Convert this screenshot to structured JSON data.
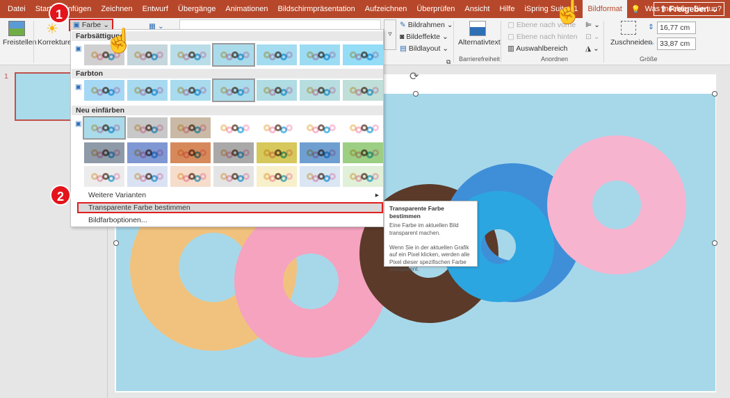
{
  "tabs": [
    "Datei",
    "Start",
    "Einfügen",
    "Zeichnen",
    "Entwurf",
    "Übergänge",
    "Animationen",
    "Bildschirmpräsentation",
    "Aufzeichnen",
    "Überprüfen",
    "Ansicht",
    "Hilfe",
    "iSpring Suite 11",
    "Bildformat"
  ],
  "active_tab": "Bildformat",
  "tell_me": "Was möchten Sie tun?",
  "share": "Freigeben",
  "ribbon": {
    "freistellen": "Freistellen",
    "korrekturen": "Korrekturen",
    "farbe": "Farbe",
    "bildrahmen": "Bildrahmen",
    "bildeffekte": "Bildeffekte",
    "bildlayout": "Bildlayout",
    "alternativtext": "Alternativtext",
    "barrierefreiheit": "Barrierefreiheit",
    "ebene_vor": "Ebene nach vorne",
    "ebene_hinten": "Ebene nach hinten",
    "auswahlbereich": "Auswahlbereich",
    "anordnen": "Anordnen",
    "zuschneiden": "Zuschneiden",
    "height": "16,77 cm",
    "width": "33,87 cm",
    "groesse": "Größe"
  },
  "slide_number": "1",
  "menu": {
    "farbsaettigung": "Farbsättigung",
    "farbton": "Farbton",
    "neu_einfaerben": "Neu einfärben",
    "weitere": "Weitere Varianten",
    "transparent": "Transparente Farbe bestimmen",
    "optionen": "Bildfarboptionen..."
  },
  "swatch_colors": {
    "saturation": [
      "#d0d0d0",
      "#c5d6dc",
      "#b9dde8",
      "#aadbeb",
      "#a3dcf0",
      "#9cdcf3",
      "#94ddf7"
    ],
    "tone": [
      "#a5d8f4",
      "#a7daf0",
      "#a8dbee",
      "#aadbeb",
      "#b0dce4",
      "#b7dde0",
      "#bfdfd8"
    ],
    "recolor1": [
      "#aadbeb",
      "#c8c8c8",
      "#c9b9a6",
      "#ffffff",
      "#ffffff",
      "#ffffff",
      "#ffffff"
    ],
    "recolor2": [
      "#8e9aa8",
      "#7f97d2",
      "#d68a5b",
      "#a9a9a9",
      "#d6c85a",
      "#6f9fd0",
      "#9ccf83"
    ],
    "recolor3": [
      "#ececec",
      "#d9e2f3",
      "#f6dccb",
      "#e4e4e4",
      "#f8f0cb",
      "#dbe6f3",
      "#e1f0d9"
    ]
  },
  "tooltip": {
    "title": "Transparente Farbe bestimmen",
    "p1": "Eine Farbe im aktuellen Bild transparent machen.",
    "p2": "Wenn Sie in der aktuellen Grafik auf ein Pixel klicken, werden alle Pixel dieser spezifischen Farbe transparent."
  },
  "badges": [
    "1",
    "2"
  ],
  "colors": {
    "accent": "#b7472a",
    "highlight": "#e01e1e",
    "picture_bg": "#a7d8ea"
  }
}
